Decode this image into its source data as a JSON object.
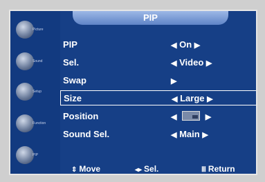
{
  "title": "PIP",
  "sidebar": [
    {
      "label": "Picture",
      "icon": "picture-icon"
    },
    {
      "label": "Sound",
      "icon": "sound-icon"
    },
    {
      "label": "Setup",
      "icon": "setup-icon"
    },
    {
      "label": "Function",
      "icon": "function-icon"
    },
    {
      "label": "PIP",
      "icon": "pip-icon"
    }
  ],
  "menu": [
    {
      "label": "PIP",
      "value": "On",
      "left": "◀",
      "right": "▶"
    },
    {
      "label": "Sel.",
      "value": "Video",
      "left": "◀",
      "right": "▶"
    },
    {
      "label": "Swap",
      "value": "",
      "left": "",
      "right": "▶"
    },
    {
      "label": "Size",
      "value": "Large",
      "left": "◀",
      "right": "▶",
      "selected": true
    },
    {
      "label": "Position",
      "value": "",
      "left": "◀",
      "right": "▶",
      "swatch": true
    },
    {
      "label": "Sound Sel.",
      "value": "Main",
      "left": "◀",
      "right": "▶"
    }
  ],
  "bottom": {
    "move": "Move",
    "sel": "Sel.",
    "return": "Return",
    "move_icon": "up-down-icon",
    "sel_icon": "left-right-icon",
    "return_icon": "menu-icon"
  }
}
